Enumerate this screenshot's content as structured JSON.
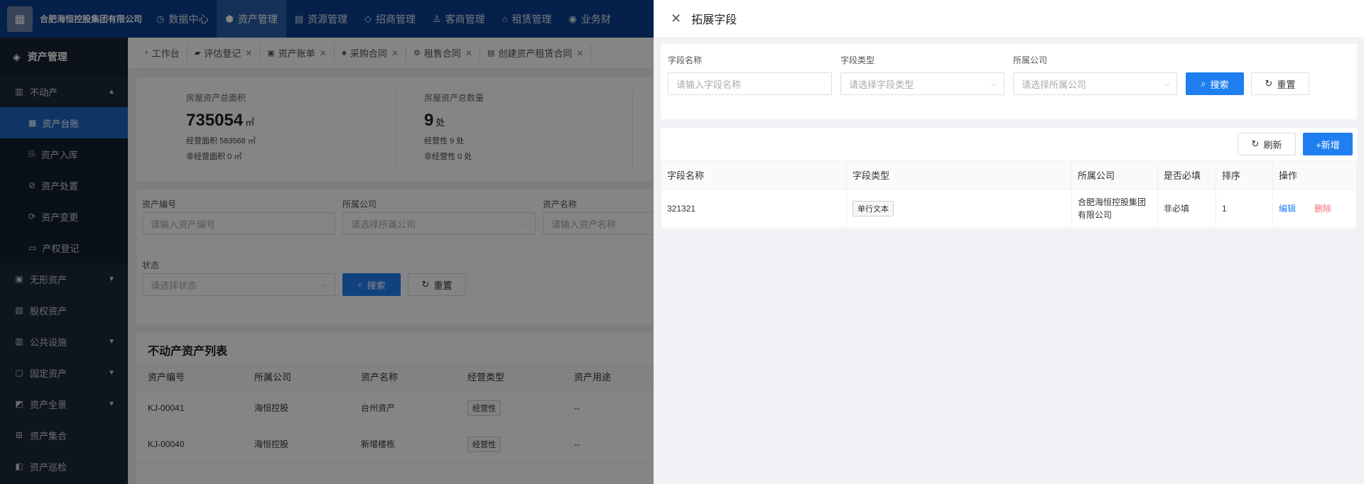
{
  "header": {
    "company": "合肥海恒控股集团有限公司",
    "nav": [
      {
        "label": "数据中心",
        "icon": "dashboard-icon"
      },
      {
        "label": "资产管理",
        "icon": "asset-icon"
      },
      {
        "label": "资源管理",
        "icon": "resource-icon"
      },
      {
        "label": "招商管理",
        "icon": "invest-icon"
      },
      {
        "label": "客商管理",
        "icon": "merchant-icon"
      },
      {
        "label": "租赁管理",
        "icon": "lease-icon"
      },
      {
        "label": "业务财",
        "icon": "finance-icon"
      }
    ]
  },
  "sidebar": {
    "title": "资产管理",
    "items": [
      {
        "label": "不动产"
      },
      {
        "label": "资产台账"
      },
      {
        "label": "资产入库"
      },
      {
        "label": "资产处置"
      },
      {
        "label": "资产变更"
      },
      {
        "label": "产权登记"
      },
      {
        "label": "无形资产"
      },
      {
        "label": "股权资产"
      },
      {
        "label": "公共设施"
      },
      {
        "label": "固定资产"
      },
      {
        "label": "资产全景"
      },
      {
        "label": "资产集合"
      },
      {
        "label": "资产巡检"
      }
    ]
  },
  "tabs": [
    {
      "label": "工作台"
    },
    {
      "label": "评估登记"
    },
    {
      "label": "资产账单"
    },
    {
      "label": "采购合同"
    },
    {
      "label": "租售合同"
    },
    {
      "label": "创建资产租赁合同"
    }
  ],
  "stats": {
    "area": {
      "label": "房屋资产总面积",
      "value": "735054",
      "unit": "㎡",
      "sub1": "经营面积 583568 ㎡",
      "sub2": "非经营面积 0 ㎡"
    },
    "count": {
      "label": "房屋资产总数量",
      "value": "9",
      "unit": "处",
      "sub1": "经营性 9 处",
      "sub2": "非经营性 0 处"
    }
  },
  "filter": {
    "code_label": "资产编号",
    "code_placeholder": "请输入资产编号",
    "company_label": "所属公司",
    "company_placeholder": "请选择所属公司",
    "name_label": "资产名称",
    "name_placeholder": "请输入资产名称",
    "status_label": "状态",
    "status_placeholder": "请选择状态",
    "search": "搜索",
    "reset": "重置"
  },
  "list": {
    "title": "不动产资产列表",
    "columns": [
      "资产编号",
      "所属公司",
      "资产名称",
      "经营类型",
      "资产用途"
    ],
    "rows": [
      [
        "KJ-00041",
        "海恒控股",
        "台州资产",
        "经营性",
        "--"
      ],
      [
        "KJ-00040",
        "海恒控股",
        "新增楼栋",
        "经营性",
        "--"
      ]
    ]
  },
  "drawer": {
    "title": "拓展字段",
    "filter": {
      "name_label": "字段名称",
      "name_placeholder": "请输入字段名称",
      "type_label": "字段类型",
      "type_placeholder": "请选择字段类型",
      "company_label": "所属公司",
      "company_placeholder": "请选择所属公司",
      "search": "搜索",
      "reset": "重置"
    },
    "refresh": "刷新",
    "add": "+新增",
    "columns": [
      "字段名称",
      "字段类型",
      "所属公司",
      "是否必填",
      "排序",
      "操作"
    ],
    "row": {
      "name": "321321",
      "type": "单行文本",
      "company": "合肥海恒控股集团有限公司",
      "required": "非必填",
      "order": "1",
      "edit": "编辑",
      "delete": "删除"
    }
  },
  "colors": {
    "primary": "#1f7ff0",
    "topbar": "#0b3e8f",
    "sidebar": "#1e2a3a",
    "danger": "#f56c6c"
  }
}
